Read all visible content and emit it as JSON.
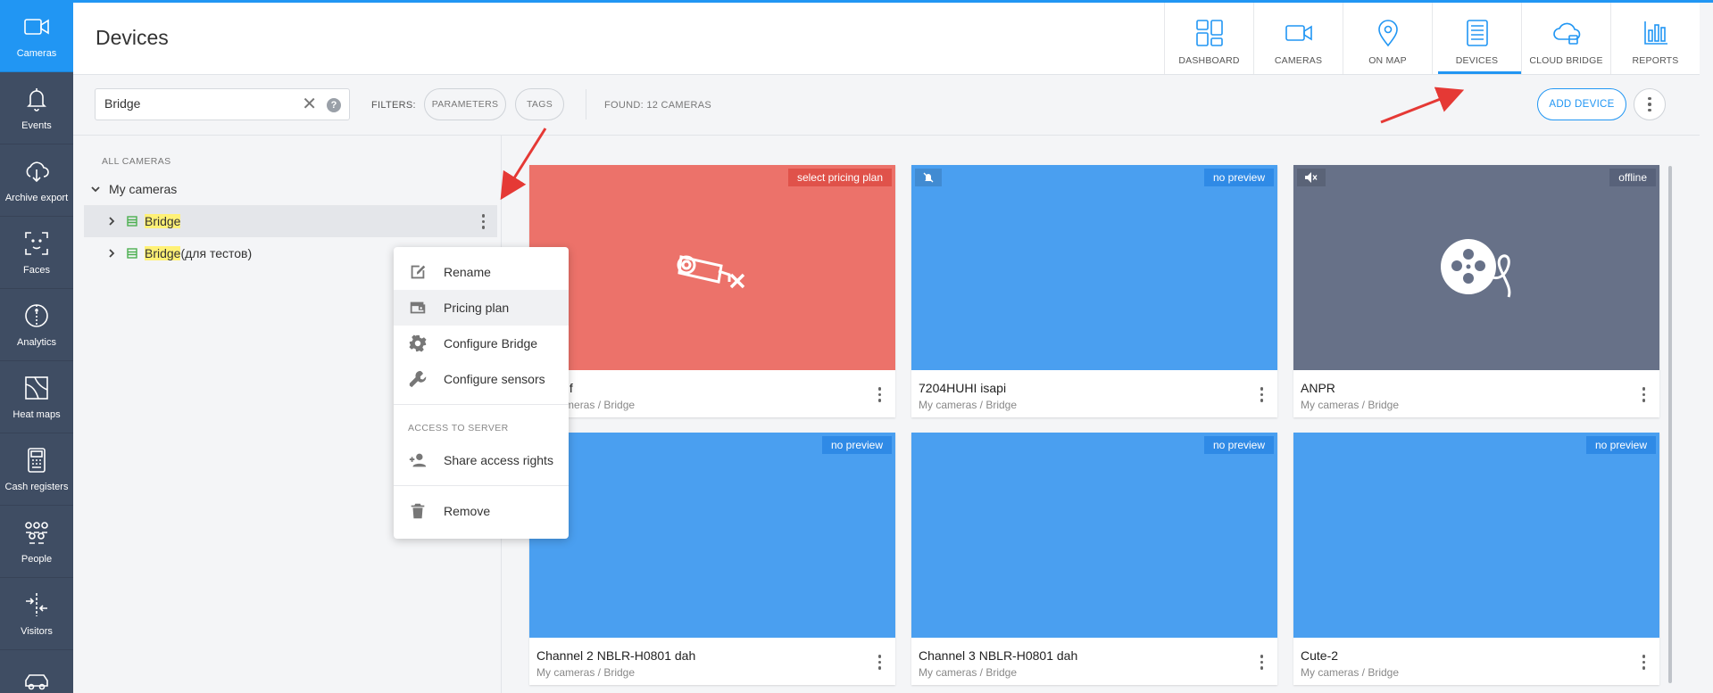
{
  "leftnav": [
    {
      "label": "Cameras",
      "icon": "video-camera-icon",
      "active": true
    },
    {
      "label": "Events",
      "icon": "bell-icon"
    },
    {
      "label": "Archive export",
      "icon": "cloud-download-icon"
    },
    {
      "label": "Faces",
      "icon": "face-scan-icon"
    },
    {
      "label": "Analytics",
      "icon": "analytics-icon"
    },
    {
      "label": "Heat maps",
      "icon": "heat-map-icon"
    },
    {
      "label": "Cash registers",
      "icon": "cash-register-icon"
    },
    {
      "label": "People",
      "icon": "people-icon"
    },
    {
      "label": "Visitors",
      "icon": "visitors-icon"
    },
    {
      "label": "",
      "icon": "car-icon"
    }
  ],
  "header": {
    "title": "Devices",
    "nav": [
      {
        "label": "DASHBOARD",
        "icon": "dashboard-icon"
      },
      {
        "label": "CAMERAS",
        "icon": "video-camera-icon"
      },
      {
        "label": "ON MAP",
        "icon": "map-pin-icon"
      },
      {
        "label": "DEVICES",
        "icon": "devices-icon",
        "active": true
      },
      {
        "label": "CLOUD BRIDGE",
        "icon": "cloud-bridge-icon"
      },
      {
        "label": "REPORTS",
        "icon": "reports-icon"
      }
    ]
  },
  "filterbar": {
    "search_value": "Bridge",
    "filters_label": "FILTERS:",
    "chip_parameters": "PARAMETERS",
    "chip_tags": "TAGS",
    "found": "FOUND: 12 CAMERAS",
    "add_device": "ADD DEVICE",
    "clear_glyph": "✕",
    "help_glyph": "?"
  },
  "tree": {
    "title": "ALL CAMERAS",
    "root": "My cameras",
    "items": [
      {
        "highlight": "Bridge",
        "rest": ""
      },
      {
        "highlight": "Bridge",
        "rest": " (для тестов)"
      }
    ]
  },
  "context_menu": {
    "rename": "Rename",
    "pricing_plan": "Pricing plan",
    "configure_bridge": "Configure Bridge",
    "configure_sensors": "Configure sensors",
    "section": "ACCESS TO SERVER",
    "share": "Share access rights",
    "remove": "Remove"
  },
  "cards": [
    {
      "title": "onvif",
      "title_prefix": "",
      "sub": "My cameras / Bridge",
      "badge": "select pricing plan",
      "color": "#ec726a",
      "badge_color": "#e0524a",
      "art": "camera-off-icon"
    },
    {
      "title": "7204HUHI isapi",
      "sub": "My cameras / Bridge",
      "badge": "no preview",
      "color": "#4a9ff0",
      "badge_color": "#2f8ae6",
      "art": "bell-off-icon"
    },
    {
      "title": "ANPR",
      "sub": "My cameras / Bridge",
      "badge": "offline",
      "color": "#677188",
      "badge_color": "#58627a",
      "art": "film-reel-icon"
    },
    {
      "title": "Channel 2 NBLR-H0801 dah",
      "sub": "My cameras / Bridge",
      "badge": "no preview",
      "color": "#4a9ff0",
      "badge_color": "#2f8ae6"
    },
    {
      "title": "Channel 3 NBLR-H0801 dah",
      "sub": "My cameras / Bridge",
      "badge": "no preview",
      "color": "#4a9ff0",
      "badge_color": "#2f8ae6"
    },
    {
      "title": "Cute-2",
      "sub": "My cameras / Bridge",
      "badge": "no preview",
      "color": "#4a9ff0",
      "badge_color": "#2f8ae6"
    }
  ],
  "colors": {
    "accent": "#2196f3",
    "sidebar": "#3f4d63",
    "device_green": "#4caf50",
    "highlight": "#fff176",
    "arrow": "#e53935"
  }
}
